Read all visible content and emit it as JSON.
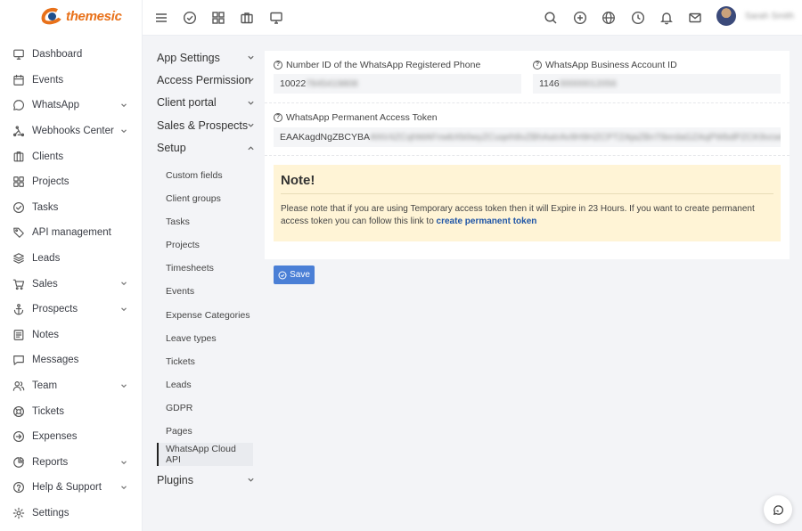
{
  "brand": {
    "logo_text": "themesic"
  },
  "topbar": {
    "icons": [
      "menu-icon",
      "check-circle-icon",
      "grid-icon",
      "briefcase-icon",
      "monitor-icon",
      "search-icon",
      "plus-circle-icon",
      "globe-icon",
      "clock-icon",
      "bell-icon",
      "mail-icon"
    ],
    "user_name": "Sarah Smith"
  },
  "sidebar": {
    "items": [
      {
        "label": "Dashboard",
        "icon": "monitor-icon",
        "has_submenu": false
      },
      {
        "label": "Events",
        "icon": "calendar-icon",
        "has_submenu": false
      },
      {
        "label": "WhatsApp",
        "icon": "chat-icon",
        "has_submenu": true
      },
      {
        "label": "Webhooks Center",
        "icon": "webhook-icon",
        "has_submenu": true
      },
      {
        "label": "Clients",
        "icon": "clients-icon",
        "has_submenu": false
      },
      {
        "label": "Projects",
        "icon": "grid-icon",
        "has_submenu": false
      },
      {
        "label": "Tasks",
        "icon": "check-circle-icon",
        "has_submenu": false
      },
      {
        "label": "API management",
        "icon": "tag-icon",
        "has_submenu": false
      },
      {
        "label": "Leads",
        "icon": "layers-icon",
        "has_submenu": false
      },
      {
        "label": "Sales",
        "icon": "cart-icon",
        "has_submenu": true
      },
      {
        "label": "Prospects",
        "icon": "anchor-icon",
        "has_submenu": true
      },
      {
        "label": "Notes",
        "icon": "note-icon",
        "has_submenu": false
      },
      {
        "label": "Messages",
        "icon": "message-icon",
        "has_submenu": false
      },
      {
        "label": "Team",
        "icon": "users-icon",
        "has_submenu": true
      },
      {
        "label": "Tickets",
        "icon": "lifebuoy-icon",
        "has_submenu": false
      },
      {
        "label": "Expenses",
        "icon": "arrow-circle-icon",
        "has_submenu": false
      },
      {
        "label": "Reports",
        "icon": "pie-chart-icon",
        "has_submenu": true
      },
      {
        "label": "Help & Support",
        "icon": "help-icon",
        "has_submenu": true
      },
      {
        "label": "Settings",
        "icon": "gear-icon",
        "has_submenu": false
      }
    ]
  },
  "settings_menu": {
    "groups": [
      {
        "label": "App Settings"
      },
      {
        "label": "Access Permission"
      },
      {
        "label": "Client portal"
      },
      {
        "label": "Sales & Prospects"
      }
    ],
    "setup": {
      "label": "Setup",
      "items": [
        "Custom fields",
        "Client groups",
        "Tasks",
        "Projects",
        "Timesheets",
        "Events",
        "Expense Categories",
        "Leave types",
        "Tickets",
        "Leads",
        "GDPR",
        "Pages",
        "WhatsApp Cloud API"
      ],
      "active_item": "WhatsApp Cloud API"
    },
    "plugins_label": "Plugins"
  },
  "form": {
    "phone_id": {
      "label": "Number ID of the WhatsApp Registered Phone",
      "value_visible": "10022",
      "value_masked": "7845419808"
    },
    "business_id": {
      "label": "WhatsApp Business Account ID",
      "value_visible": "1146",
      "value_masked": "00000012056"
    },
    "token": {
      "label": "WhatsApp Permanent Access Token",
      "value_visible": "EAAKagdNgZBCYBA",
      "value_masked": "ANV4ZCqhMAFnwbXb0wyZCuqeh8vZBhAaIrAv9H9HZCPTZAjaZBnT8erdaGZAqPWbdPZCK9vcwGwMhZBeyZB"
    }
  },
  "note": {
    "title": "Note!",
    "body": "Please note that if you are using Temporary access token then it will Expire in 23 Hours. If you want to create permanent access token you can follow this link to",
    "link_text": "create permanent token"
  },
  "actions": {
    "save_label": "Save"
  },
  "colors": {
    "accent": "#4a7fd6",
    "note_bg": "#fff4d6",
    "brand": "#e8711a"
  }
}
